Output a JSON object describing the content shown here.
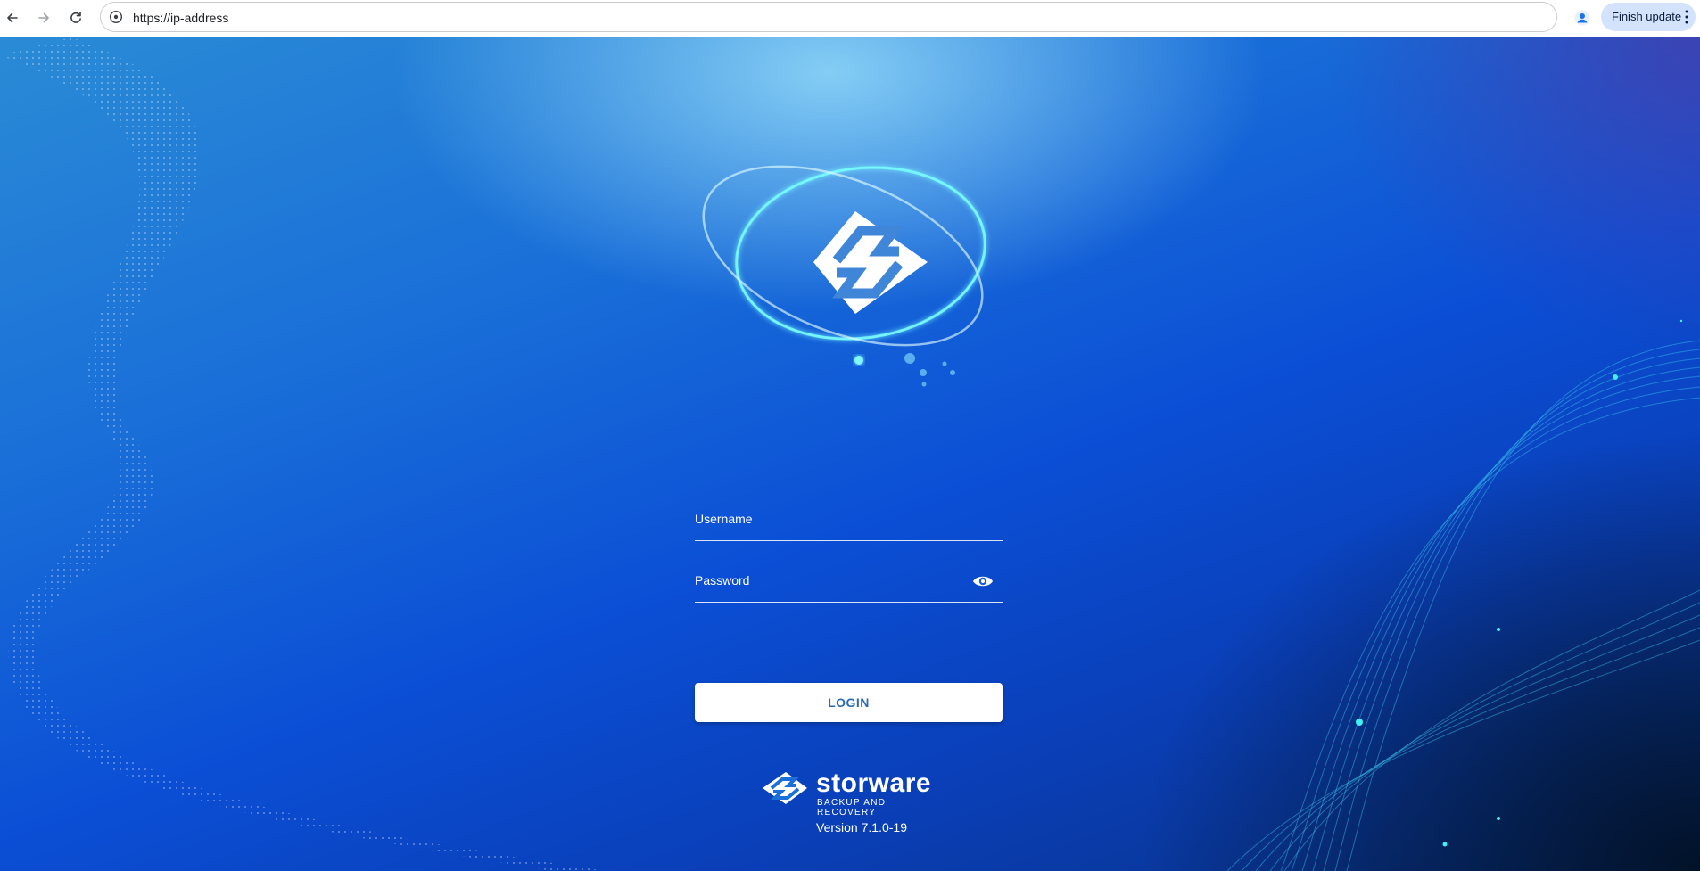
{
  "browser": {
    "url": "https://ip-address",
    "update_label": "Finish update",
    "icons": {
      "back": "arrow-left-icon",
      "forward": "arrow-right-icon",
      "reload": "reload-icon",
      "site_info": "site-info-icon",
      "profile": "profile-icon",
      "menu": "kebab-menu-icon"
    }
  },
  "login": {
    "username_label": "Username",
    "password_label": "Password",
    "submit_label": "LOGIN",
    "password_toggle_icon": "eye-icon"
  },
  "branding": {
    "name": "storware",
    "tagline": "BACKUP AND RECOVERY",
    "version": "Version 7.1.0-19"
  },
  "colors": {
    "background_primary": "#0b4fd6",
    "background_light": "#2a8bd6",
    "accent_cyan": "#22e5f0",
    "login_text": "#2a6bb5",
    "update_pill": "#d3e3fd"
  }
}
